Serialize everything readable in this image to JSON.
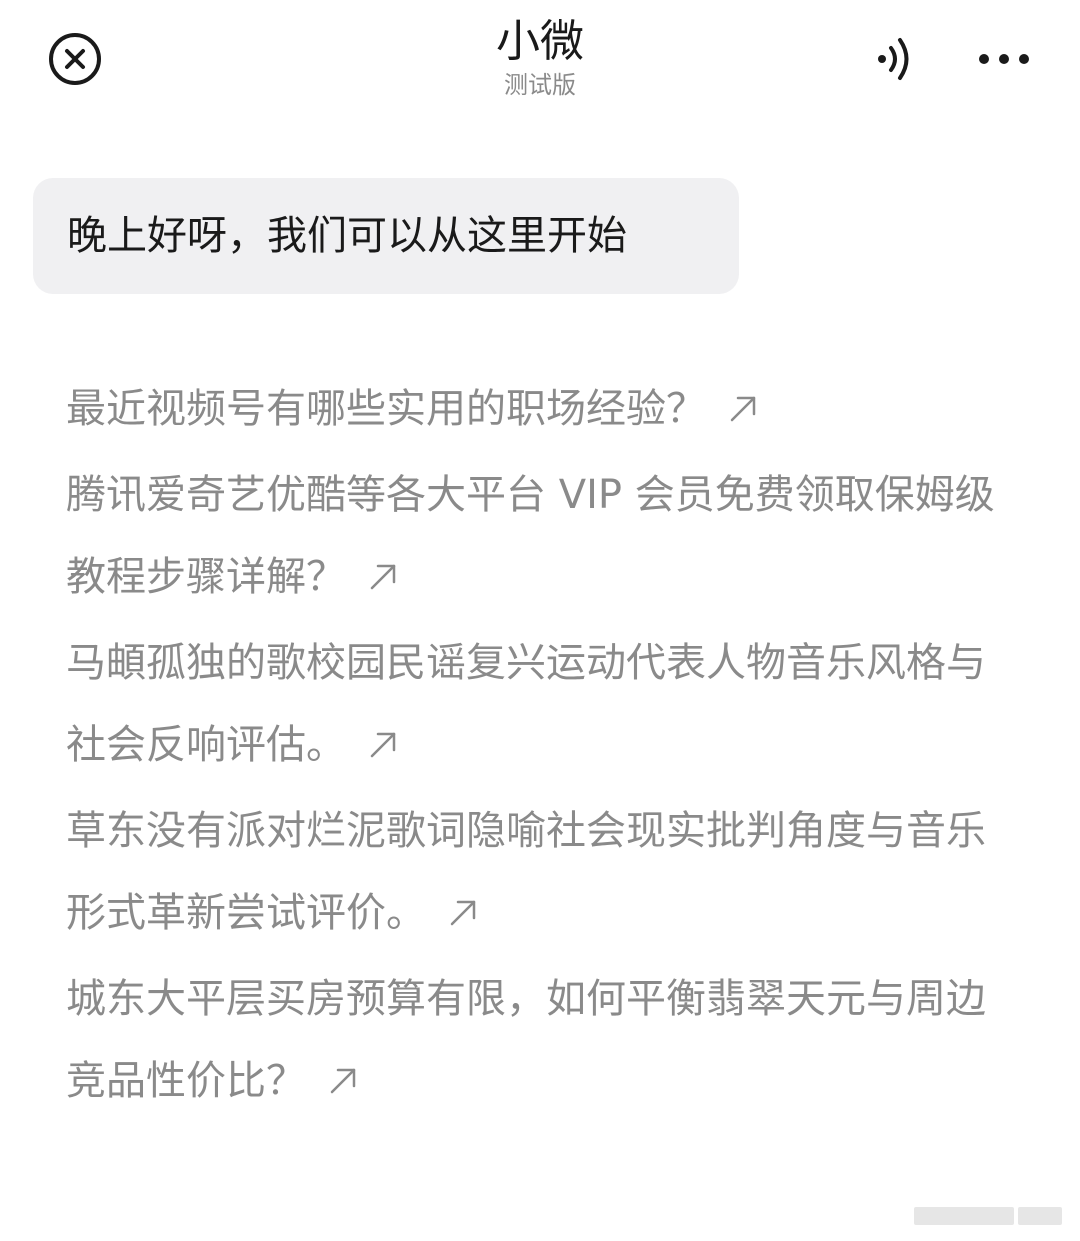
{
  "header": {
    "title": "小微",
    "subtitle": "测试版",
    "close_icon": "close-circle-icon",
    "voice_icon": "voice-icon",
    "more_icon": "more-dots-icon"
  },
  "greeting": {
    "text": "晚上好呀，我们可以从这里开始"
  },
  "suggestions": [
    {
      "text": "最近视频号有哪些实用的职场经验？"
    },
    {
      "text": "腾讯爱奇艺优酷等各大平台 VIP 会员免费领取保姆级教程步骤详解？"
    },
    {
      "text": "马頔孤独的歌校园民谣复兴运动代表人物音乐风格与社会反响评估。"
    },
    {
      "text": "草东没有派对烂泥歌词隐喻社会现实批判角度与音乐形式革新尝试评价。"
    },
    {
      "text": "城东大平层买房预算有限，如何平衡翡翠天元与周边竞品性价比？"
    }
  ],
  "colors": {
    "title": "#1a1a1a",
    "subtitle": "#8a8a8a",
    "bubble_bg": "#f0f0f2",
    "suggestion_text": "#8a8a8a"
  }
}
